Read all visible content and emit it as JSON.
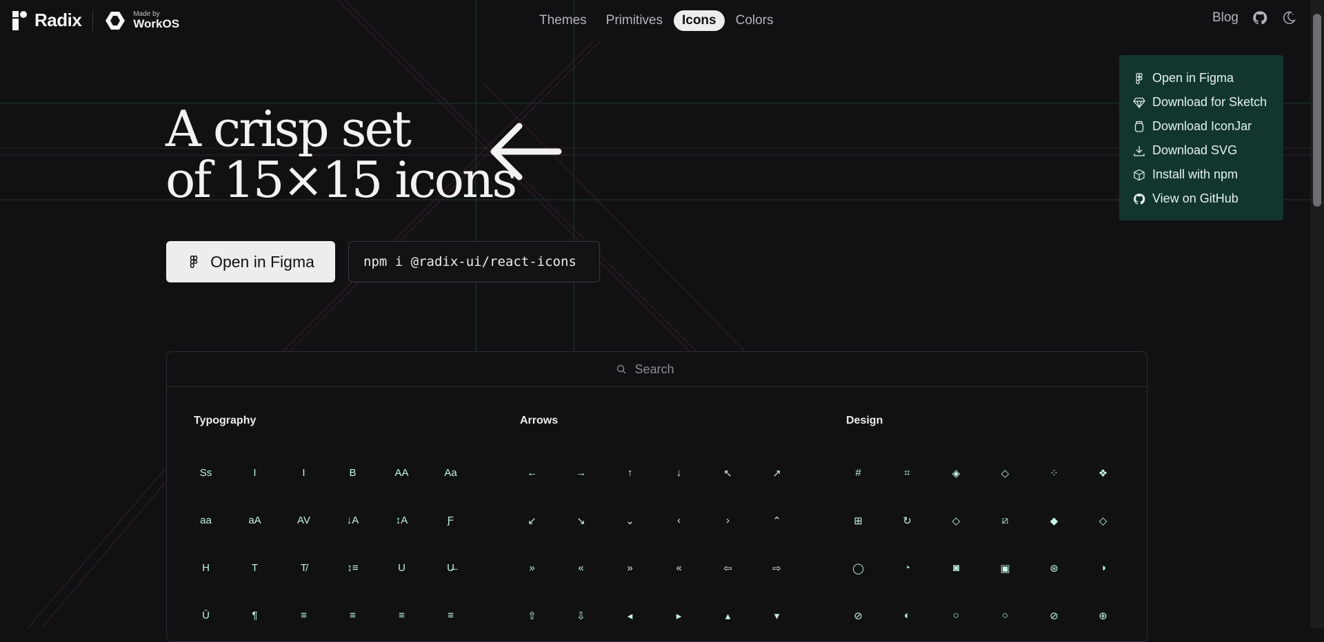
{
  "brand": {
    "name": "Radix",
    "made_by": "Made by",
    "partner": "WorkOS"
  },
  "nav": {
    "items": [
      {
        "label": "Themes",
        "active": false
      },
      {
        "label": "Primitives",
        "active": false
      },
      {
        "label": "Icons",
        "active": true
      },
      {
        "label": "Colors",
        "active": false
      }
    ],
    "blog": "Blog"
  },
  "dropdown": {
    "items": [
      {
        "label": "Open in Figma",
        "icon": "figma-icon"
      },
      {
        "label": "Download for Sketch",
        "icon": "sketch-icon"
      },
      {
        "label": "Download IconJar",
        "icon": "iconjar-icon"
      },
      {
        "label": "Download SVG",
        "icon": "download-icon"
      },
      {
        "label": "Install with npm",
        "icon": "cube-icon"
      },
      {
        "label": "View on GitHub",
        "icon": "github-icon"
      }
    ]
  },
  "hero": {
    "line1": "A crisp set",
    "line2": "of 15×15 icons",
    "figma_button": "Open in Figma",
    "npm_command": "npm i @radix-ui/react-icons"
  },
  "search": {
    "placeholder": "Search"
  },
  "categories": [
    {
      "title": "Typography",
      "icons": [
        "Ss",
        "I",
        "I",
        "B",
        "AA",
        "Aa",
        "aa",
        "aA",
        "AV",
        "↓A",
        "↕A",
        "Ƒ",
        "H",
        "T",
        "T̸",
        "↕≡",
        "U",
        "U̶",
        "Ū",
        "¶",
        "≡",
        "≡",
        "≡",
        "≡"
      ]
    },
    {
      "title": "Arrows",
      "icons": [
        "←",
        "→",
        "↑",
        "↓",
        "↖",
        "↗",
        "↙",
        "↘",
        "⌄",
        "‹",
        "›",
        "⌃",
        "»",
        "«",
        "»",
        "«",
        "⇦",
        "⇨",
        "⇧",
        "⇩",
        "◂",
        "▸",
        "▴",
        "▾"
      ]
    },
    {
      "title": "Design",
      "icons": [
        "#",
        "⌗",
        "◈",
        "◇",
        "⁘",
        "❖",
        "⊞",
        "↻",
        "◇",
        "⧄",
        "◆",
        "◇",
        "◯",
        "◔",
        "◙",
        "▣",
        "⊛",
        "◑",
        "⊘",
        "◐",
        "○",
        "○",
        "⊘",
        "⊕"
      ]
    }
  ],
  "colors": {
    "accent": "#c6f4e5",
    "dropdown_bg": "#12362e",
    "background": "#111113"
  }
}
